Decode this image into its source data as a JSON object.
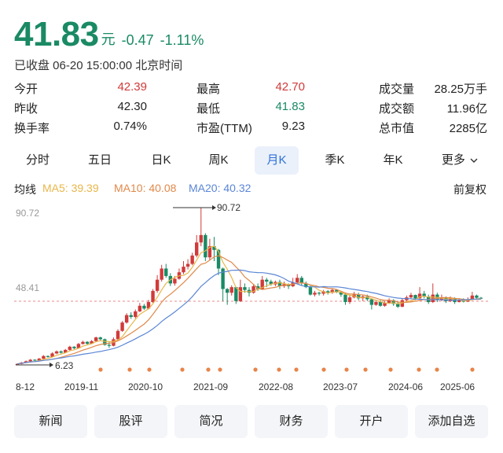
{
  "quote": {
    "price": "41.83",
    "unit": "元",
    "change": "-0.47",
    "change_pct": "-1.11%",
    "status_line": "已收盘 06-20 15:00:00 北京时间",
    "colors": {
      "up": "#d13a3a",
      "down": "#1a8a64",
      "accent": "#2d6fd8"
    }
  },
  "stats": {
    "rows": [
      [
        {
          "label": "今开",
          "value": "42.39"
        },
        {
          "label": "最高",
          "value": "42.70"
        },
        {
          "label": "成交量",
          "value": "28.25万手"
        }
      ],
      [
        {
          "label": "昨收",
          "value": "42.30"
        },
        {
          "label": "最低",
          "value": "41.83"
        },
        {
          "label": "成交额",
          "value": "11.96亿"
        }
      ],
      [
        {
          "label": "换手率",
          "value": "0.74%"
        },
        {
          "label": "市盈(TTM)",
          "value": "9.23"
        },
        {
          "label": "总市值",
          "value": "2285亿"
        }
      ]
    ]
  },
  "tabs": {
    "items": [
      "分时",
      "五日",
      "日K",
      "周K",
      "月K",
      "季K",
      "年K",
      "更多"
    ],
    "active": "月K"
  },
  "ma": {
    "title": "均线",
    "ma5": "MA5: 39.39",
    "ma10": "MA10: 40.08",
    "ma20": "MA20: 40.32",
    "adjust": "前复权",
    "colors": {
      "ma5": "#e8b64a",
      "ma10": "#e0894a",
      "ma20": "#5b86d6"
    }
  },
  "chart_data": {
    "type": "candlestick",
    "y_top_label": "90.72",
    "y_mid_label": "48.41",
    "y_range": [
      6.23,
      90.72
    ],
    "max_label": "90.72",
    "min_label": "6.23",
    "last_close": 41.83,
    "x_labels": [
      "8-12",
      "2019-11",
      "2020-10",
      "2021-09",
      "2022-08",
      "2023-07",
      "2024-06",
      "2025-06"
    ],
    "candles": [
      [
        6.2,
        6.8,
        6.0,
        7.0
      ],
      [
        6.8,
        7.5,
        6.6,
        7.8
      ],
      [
        7.5,
        8.2,
        7.3,
        8.6
      ],
      [
        8.2,
        9.0,
        8.0,
        9.4
      ],
      [
        9.0,
        8.6,
        8.3,
        9.3
      ],
      [
        8.6,
        9.6,
        8.5,
        10.0
      ],
      [
        9.6,
        11.0,
        9.4,
        11.5
      ],
      [
        11.0,
        10.5,
        10.2,
        11.3
      ],
      [
        10.5,
        12.4,
        10.3,
        13.0
      ],
      [
        12.4,
        13.5,
        12.0,
        14.0
      ],
      [
        13.5,
        12.8,
        12.4,
        14.0
      ],
      [
        12.8,
        14.3,
        12.6,
        14.8
      ],
      [
        14.3,
        16.0,
        14.0,
        16.5
      ],
      [
        16.0,
        15.2,
        14.7,
        16.3
      ],
      [
        15.2,
        17.5,
        15.0,
        18.0
      ],
      [
        17.5,
        18.6,
        17.2,
        19.2
      ],
      [
        18.6,
        17.6,
        17.0,
        19.0
      ],
      [
        17.6,
        19.0,
        17.4,
        19.6
      ],
      [
        19.0,
        21.0,
        18.6,
        21.4
      ],
      [
        21.0,
        20.0,
        19.5,
        21.4
      ],
      [
        20.0,
        17.0,
        16.6,
        20.4
      ],
      [
        17.0,
        16.5,
        15.4,
        18.4
      ],
      [
        16.5,
        20.0,
        16.2,
        21.0
      ],
      [
        20.0,
        24.5,
        19.8,
        25.4
      ],
      [
        24.5,
        29.0,
        24.0,
        29.8
      ],
      [
        29.0,
        33.0,
        28.4,
        34.0
      ],
      [
        33.0,
        32.0,
        31.0,
        34.5
      ],
      [
        32.0,
        35.0,
        31.2,
        36.0
      ],
      [
        35.0,
        38.0,
        34.6,
        39.5
      ],
      [
        38.0,
        36.5,
        35.8,
        39.0
      ],
      [
        36.5,
        40.0,
        36.0,
        41.2
      ],
      [
        40.0,
        46.0,
        39.6,
        47.0
      ],
      [
        46.0,
        52.0,
        45.0,
        54.5
      ],
      [
        52.0,
        58.0,
        51.0,
        60.0
      ],
      [
        58.0,
        54.0,
        53.0,
        60.5
      ],
      [
        54.0,
        50.0,
        48.6,
        55.5
      ],
      [
        50.0,
        52.5,
        48.8,
        54.0
      ],
      [
        52.5,
        56.0,
        52.0,
        58.0
      ],
      [
        56.0,
        59.0,
        55.0,
        62.0
      ],
      [
        59.0,
        60.5,
        57.5,
        63.0
      ],
      [
        60.5,
        65.0,
        59.8,
        66.5
      ],
      [
        65.0,
        72.0,
        64.0,
        76.0
      ],
      [
        72.0,
        76.0,
        70.0,
        90.72
      ],
      [
        76.0,
        64.0,
        62.0,
        77.0
      ],
      [
        64.0,
        70.0,
        62.5,
        74.0
      ],
      [
        70.0,
        68.0,
        62.0,
        75.0
      ],
      [
        68.0,
        58.0,
        54.5,
        68.5
      ],
      [
        58.0,
        47.0,
        40.5,
        58.5
      ],
      [
        47.0,
        45.0,
        38.5,
        47.5
      ],
      [
        45.0,
        48.0,
        43.5,
        49.0
      ],
      [
        48.0,
        40.5,
        39.0,
        48.2
      ],
      [
        40.5,
        48.0,
        40.0,
        52.0
      ],
      [
        48.0,
        46.5,
        45.0,
        50.0
      ],
      [
        46.5,
        45.0,
        43.0,
        48.0
      ],
      [
        45.0,
        48.5,
        44.5,
        49.5
      ],
      [
        48.5,
        47.0,
        46.0,
        50.0
      ],
      [
        47.0,
        52.0,
        46.6,
        54.0
      ],
      [
        52.0,
        51.0,
        48.0,
        53.0
      ],
      [
        51.0,
        49.5,
        48.8,
        52.0
      ],
      [
        49.5,
        50.8,
        48.5,
        51.5
      ],
      [
        50.8,
        48.6,
        47.0,
        52.0
      ],
      [
        48.6,
        49.6,
        47.6,
        51.0
      ],
      [
        49.6,
        48.5,
        47.0,
        50.0
      ],
      [
        48.5,
        50.5,
        48.0,
        53.0
      ],
      [
        50.5,
        53.0,
        50.0,
        55.0
      ],
      [
        53.0,
        50.0,
        49.0,
        54.0
      ],
      [
        50.0,
        48.0,
        47.5,
        51.0
      ],
      [
        48.0,
        44.0,
        43.5,
        49.0
      ],
      [
        44.0,
        45.0,
        43.0,
        46.0
      ],
      [
        45.0,
        44.5,
        43.5,
        45.5
      ],
      [
        44.5,
        45.8,
        43.5,
        46.5
      ],
      [
        45.8,
        45.0,
        44.0,
        46.5
      ],
      [
        45.0,
        46.5,
        44.5,
        47.0
      ],
      [
        46.5,
        45.5,
        44.8,
        47.0
      ],
      [
        45.5,
        44.0,
        42.8,
        46.0
      ],
      [
        44.0,
        40.0,
        38.5,
        45.0
      ],
      [
        40.0,
        42.5,
        39.0,
        43.5
      ],
      [
        42.5,
        44.0,
        42.0,
        45.5
      ],
      [
        44.0,
        42.0,
        41.0,
        45.0
      ],
      [
        42.0,
        43.0,
        40.5,
        44.0
      ],
      [
        43.0,
        41.5,
        40.5,
        44.0
      ],
      [
        41.5,
        38.5,
        36.0,
        42.0
      ],
      [
        38.5,
        40.0,
        38.0,
        41.0
      ],
      [
        40.0,
        38.0,
        37.5,
        41.0
      ],
      [
        38.0,
        39.5,
        37.5,
        40.5
      ],
      [
        39.5,
        41.0,
        39.0,
        42.0
      ],
      [
        41.0,
        39.0,
        38.0,
        41.5
      ],
      [
        39.0,
        37.5,
        36.8,
        40.0
      ],
      [
        37.5,
        41.0,
        37.2,
        42.0
      ],
      [
        41.0,
        42.5,
        40.5,
        43.5
      ],
      [
        42.5,
        43.8,
        42.0,
        45.0
      ],
      [
        43.8,
        42.0,
        41.0,
        44.0
      ],
      [
        42.0,
        44.5,
        41.8,
        48.0
      ],
      [
        44.5,
        43.0,
        42.0,
        46.0
      ],
      [
        43.0,
        40.0,
        39.0,
        44.0
      ],
      [
        40.0,
        44.0,
        39.5,
        50.0
      ],
      [
        44.0,
        41.0,
        40.0,
        45.0
      ],
      [
        41.0,
        42.5,
        40.5,
        44.0
      ],
      [
        42.5,
        40.5,
        39.5,
        43.0
      ],
      [
        40.5,
        41.8,
        40.0,
        43.0
      ],
      [
        41.8,
        40.0,
        39.0,
        42.5
      ],
      [
        40.0,
        41.0,
        39.8,
        42.0
      ],
      [
        41.0,
        40.2,
        39.8,
        42.0
      ],
      [
        40.2,
        41.5,
        40.0,
        42.5
      ],
      [
        41.5,
        43.5,
        41.0,
        45.5
      ],
      [
        43.5,
        42.3,
        41.5,
        44.0
      ],
      [
        42.3,
        41.83,
        41.5,
        42.7
      ]
    ],
    "markers": [
      "dot",
      "dot",
      "dot",
      "dot",
      "dot",
      "dot",
      "dot",
      "dot",
      "dot",
      "dot",
      "dot",
      "dot",
      "dot",
      "dot",
      "dot",
      "dot",
      "dot",
      "dot"
    ]
  },
  "buttons": [
    "新闻",
    "股评",
    "简况",
    "财务",
    "开户",
    "添加自选"
  ]
}
